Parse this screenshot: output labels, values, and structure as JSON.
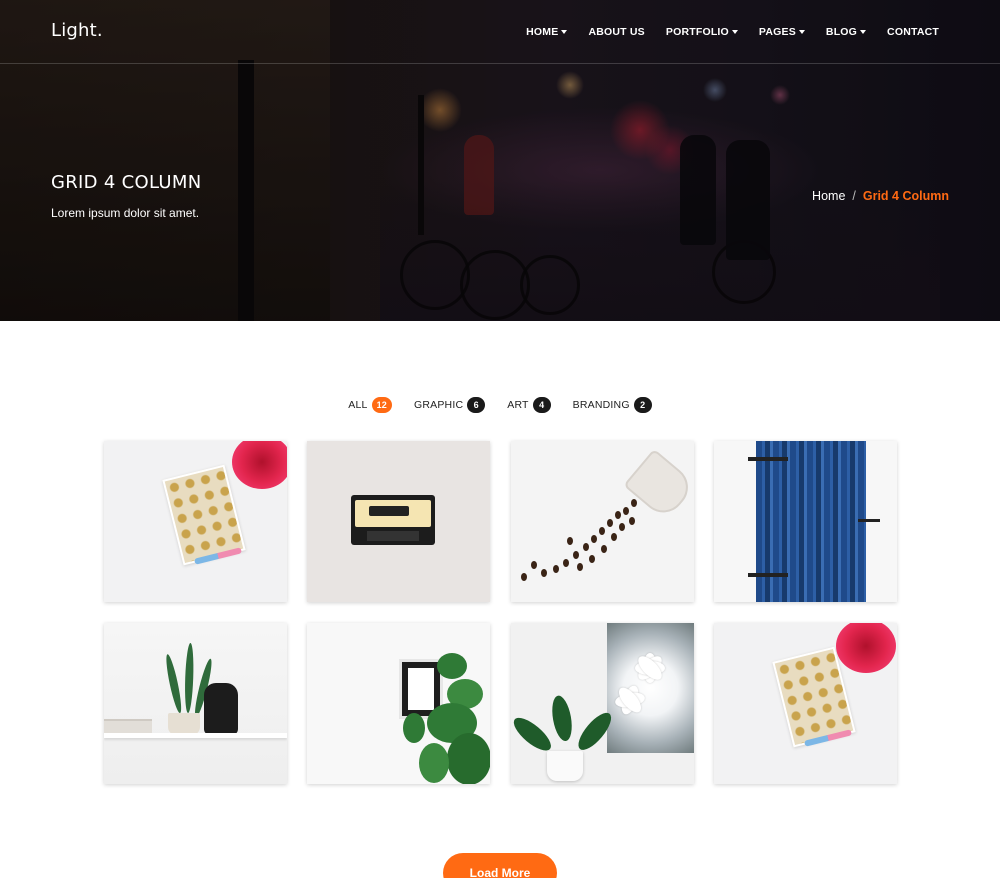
{
  "brand": {
    "logo": "Light."
  },
  "nav": {
    "items": [
      {
        "label": "HOME",
        "dropdown": true
      },
      {
        "label": "ABOUT US",
        "dropdown": false
      },
      {
        "label": "PORTFOLIO",
        "dropdown": true
      },
      {
        "label": "PAGES",
        "dropdown": true
      },
      {
        "label": "BLOG",
        "dropdown": true
      },
      {
        "label": "CONTACT",
        "dropdown": false
      }
    ]
  },
  "hero": {
    "title": "GRID 4 COLUMN",
    "subtitle": "Lorem ipsum dolor sit amet.",
    "breadcrumb": {
      "home": "Home",
      "separator": "/",
      "current": "Grid 4 Column"
    }
  },
  "filters": [
    {
      "label": "ALL",
      "count": "12",
      "active": true
    },
    {
      "label": "GRAPHIC",
      "count": "6",
      "active": false
    },
    {
      "label": "ART",
      "count": "4",
      "active": false
    },
    {
      "label": "BRANDING",
      "count": "2",
      "active": false
    }
  ],
  "portfolio": {
    "items": [
      {
        "image": "notebook-with-flower"
      },
      {
        "image": "cassette-tape"
      },
      {
        "image": "spilled-coffee-beans"
      },
      {
        "image": "blue-wooden-door"
      },
      {
        "image": "plant-and-lucky-cat-on-shelf"
      },
      {
        "image": "window-with-ivy"
      },
      {
        "image": "potted-plant-with-flower-picture"
      },
      {
        "image": "notebook-with-flower"
      }
    ]
  },
  "load_more": {
    "label": "Load More"
  },
  "colors": {
    "accent": "#ff6a13",
    "badge": "#1a1a1a",
    "hero_overlay": "#1e1519"
  }
}
